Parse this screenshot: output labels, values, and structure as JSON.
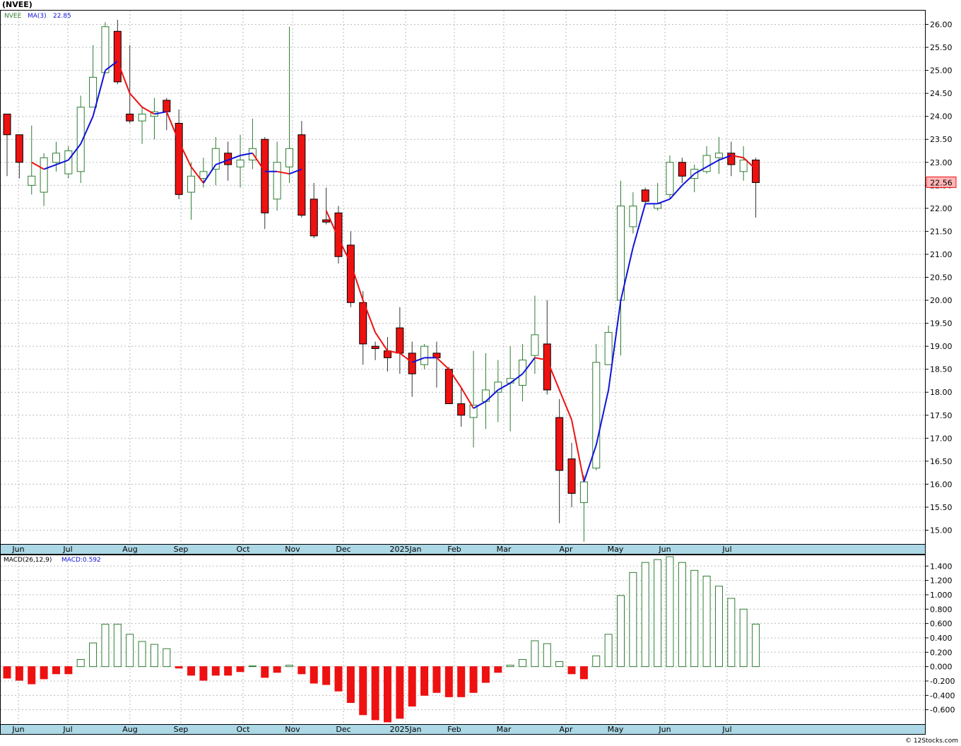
{
  "symbol": "(NVEE)",
  "price_legend": {
    "ticker": "NVEE",
    "ma_label": "MA(3)",
    "ma_value": "22.85"
  },
  "macd_legend": {
    "label": "MACD(26,12,9)",
    "value_label": "MACD:0.592"
  },
  "last_price": "22.56",
  "credit": "© 12Stocks.com",
  "colors": {
    "up": "#2e7d32",
    "down": "#ee1111",
    "ma_up": "#1111dd",
    "ma_down": "#ee1111",
    "grid": "#bbbbbb",
    "axis_strip": "#add8e6"
  },
  "chart_data": [
    {
      "type": "candlestick",
      "title": "(NVEE)",
      "period": "weekly",
      "ylim": [
        14.7,
        26.3
      ],
      "y_ticks": [
        "15.00",
        "15.50",
        "16.00",
        "16.50",
        "17.00",
        "17.50",
        "18.00",
        "18.50",
        "19.00",
        "19.50",
        "20.00",
        "20.50",
        "21.00",
        "21.50",
        "22.00",
        "22.50",
        "23.00",
        "23.50",
        "24.00",
        "24.50",
        "25.00",
        "25.50",
        "26.00"
      ],
      "x_labels": [
        "Jun",
        "Jul",
        "Aug",
        "Sep",
        "Oct",
        "Nov",
        "Dec",
        "2025Jan",
        "Feb",
        "Mar",
        "Apr",
        "May",
        "Jun",
        "Jul"
      ],
      "series": [
        {
          "name": "NVEE",
          "type": "candlestick",
          "ohlc": [
            [
              24.05,
              24.05,
              22.7,
              23.6
            ],
            [
              23.6,
              23.6,
              22.65,
              23.0
            ],
            [
              22.5,
              23.8,
              22.3,
              22.7
            ],
            [
              22.35,
              23.2,
              22.05,
              23.1
            ],
            [
              23.0,
              23.45,
              22.8,
              23.2
            ],
            [
              22.75,
              23.35,
              22.65,
              23.25
            ],
            [
              22.8,
              24.45,
              22.55,
              24.2
            ],
            [
              24.2,
              25.55,
              24.2,
              24.85
            ],
            [
              24.95,
              26.05,
              24.95,
              25.95
            ],
            [
              25.85,
              26.1,
              24.7,
              24.75
            ],
            [
              24.05,
              25.55,
              23.85,
              23.9
            ],
            [
              23.9,
              24.2,
              23.4,
              24.05
            ],
            [
              24.0,
              24.4,
              23.5,
              24.1
            ],
            [
              24.35,
              24.4,
              23.7,
              24.1
            ],
            [
              23.85,
              24.15,
              22.2,
              22.3
            ],
            [
              22.35,
              23.0,
              21.75,
              22.7
            ],
            [
              22.65,
              23.1,
              22.45,
              22.8
            ],
            [
              22.85,
              23.55,
              22.5,
              23.3
            ],
            [
              23.2,
              23.45,
              22.6,
              22.95
            ],
            [
              22.9,
              23.6,
              22.45,
              23.05
            ],
            [
              23.05,
              23.95,
              22.85,
              23.3
            ],
            [
              23.5,
              23.55,
              21.55,
              21.9
            ],
            [
              22.2,
              23.45,
              21.95,
              23.0
            ],
            [
              22.9,
              25.95,
              22.55,
              23.3
            ],
            [
              23.6,
              23.9,
              21.8,
              21.85
            ],
            [
              22.2,
              22.55,
              21.35,
              21.4
            ],
            [
              21.75,
              22.45,
              21.65,
              21.7
            ],
            [
              21.9,
              22.05,
              20.8,
              20.95
            ],
            [
              21.2,
              21.5,
              19.85,
              19.95
            ],
            [
              19.95,
              20.2,
              18.6,
              19.05
            ],
            [
              19.0,
              19.1,
              18.7,
              18.95
            ],
            [
              18.9,
              19.2,
              18.45,
              18.75
            ],
            [
              19.4,
              19.85,
              18.4,
              18.85
            ],
            [
              18.85,
              19.1,
              17.9,
              18.4
            ],
            [
              18.6,
              19.05,
              18.5,
              19.0
            ],
            [
              18.85,
              19.1,
              18.1,
              18.75
            ],
            [
              18.5,
              18.55,
              17.75,
              17.75
            ],
            [
              17.75,
              18.1,
              17.25,
              17.5
            ],
            [
              17.45,
              18.9,
              16.8,
              17.72
            ],
            [
              17.8,
              18.85,
              17.2,
              18.05
            ],
            [
              18.0,
              18.7,
              17.35,
              18.22
            ],
            [
              18.2,
              19.0,
              17.15,
              18.3
            ],
            [
              18.15,
              19.05,
              17.8,
              18.7
            ],
            [
              18.8,
              20.1,
              18.4,
              19.25
            ],
            [
              19.05,
              20.0,
              17.95,
              18.05
            ],
            [
              17.45,
              17.85,
              15.15,
              16.3
            ],
            [
              16.55,
              16.9,
              15.5,
              15.8
            ],
            [
              15.6,
              16.2,
              14.75,
              16.05
            ],
            [
              16.35,
              19.05,
              16.3,
              18.65
            ],
            [
              18.6,
              19.45,
              18.6,
              19.3
            ],
            [
              20.0,
              22.6,
              18.8,
              22.05
            ],
            [
              21.6,
              22.35,
              21.45,
              22.05
            ],
            [
              22.4,
              22.45,
              22.1,
              22.15
            ],
            [
              22.0,
              22.55,
              21.95,
              22.1
            ],
            [
              22.3,
              23.15,
              22.2,
              23.0
            ],
            [
              23.0,
              23.1,
              22.55,
              22.7
            ],
            [
              22.65,
              22.95,
              22.35,
              22.85
            ],
            [
              22.8,
              23.35,
              22.75,
              23.15
            ],
            [
              23.1,
              23.55,
              22.75,
              23.2
            ],
            [
              23.2,
              23.45,
              22.7,
              22.95
            ],
            [
              22.8,
              23.35,
              22.6,
              23.05
            ],
            [
              23.05,
              23.1,
              21.8,
              22.56
            ]
          ]
        },
        {
          "name": "MA(3)",
          "values": [
            null,
            null,
            23.0,
            22.85,
            22.95,
            23.05,
            23.4,
            24.0,
            25.0,
            25.2,
            24.5,
            24.2,
            24.05,
            24.1,
            23.45,
            22.9,
            22.55,
            22.95,
            23.05,
            23.15,
            23.2,
            22.8,
            22.8,
            22.75,
            22.85,
            null,
            21.95,
            21.35,
            20.8,
            20.0,
            19.3,
            18.9,
            18.85,
            18.65,
            18.75,
            18.75,
            18.5,
            18.1,
            17.65,
            17.8,
            18.05,
            18.2,
            18.4,
            18.75,
            18.7,
            18.05,
            17.4,
            16.05,
            16.85,
            18.05,
            20.0,
            21.15,
            22.1,
            22.1,
            22.2,
            22.5,
            22.75,
            22.9,
            23.05,
            23.15,
            23.1,
            22.85
          ]
        }
      ]
    },
    {
      "type": "bar",
      "title": "MACD(26,12,9)",
      "ylim": [
        -0.8,
        1.55
      ],
      "y_ticks": [
        "-0.600",
        "-0.400",
        "-0.200",
        "0.000",
        "0.200",
        "0.400",
        "0.600",
        "0.800",
        "1.000",
        "1.200",
        "1.400"
      ],
      "x_labels": [
        "Jun",
        "Jul",
        "Aug",
        "Sep",
        "Oct",
        "Nov",
        "Dec",
        "2025Jan",
        "Feb",
        "Mar",
        "Apr",
        "May",
        "Jun",
        "Jul"
      ],
      "series": [
        {
          "name": "MACD",
          "values": [
            -0.16,
            -0.19,
            -0.24,
            -0.17,
            -0.1,
            -0.1,
            0.1,
            0.33,
            0.59,
            0.59,
            0.45,
            0.35,
            0.31,
            0.25,
            -0.02,
            -0.12,
            -0.19,
            -0.12,
            -0.12,
            -0.07,
            0.01,
            -0.15,
            -0.08,
            0.02,
            -0.1,
            -0.23,
            -0.25,
            -0.34,
            -0.5,
            -0.67,
            -0.74,
            -0.77,
            -0.72,
            -0.55,
            -0.4,
            -0.36,
            -0.42,
            -0.42,
            -0.36,
            -0.22,
            -0.08,
            0.02,
            0.1,
            0.36,
            0.32,
            0.07,
            -0.1,
            -0.17,
            0.15,
            0.45,
            0.99,
            1.31,
            1.45,
            1.49,
            1.53,
            1.45,
            1.34,
            1.26,
            1.12,
            0.95,
            0.8,
            0.592
          ]
        }
      ]
    }
  ]
}
